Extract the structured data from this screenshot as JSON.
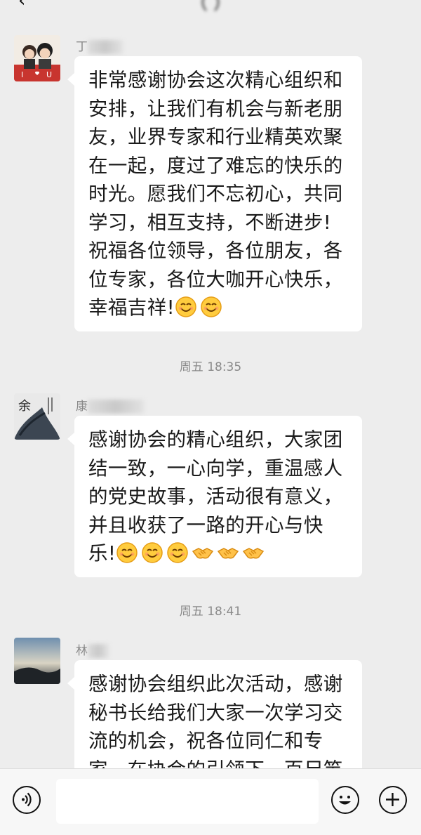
{
  "header": {
    "back_glyph": "‹",
    "title": "(obscured chat title)"
  },
  "messages": [
    {
      "sender": "丁",
      "text": "非常感谢协会这次精心组织和安排，让我们有机会与新老朋友，业界专家和行业精英欢聚在一起，度过了难忘的快乐的时光。愿我们不忘初心，共同学习，相互支持，不断进步!祝福各位领导，各位朋友，各位专家，各位大咖开心快乐，幸福吉祥!",
      "emojis": [
        "smile-emoji",
        "smile-emoji"
      ]
    },
    {
      "sender": "康",
      "text": "感谢协会的精心组织，大家团结一致，一心向学，重温感人的党史故事，活动很有意义，并且收获了一路的开心与快乐!",
      "emojis": [
        "smile-emoji",
        "smile-emoji",
        "smile-emoji",
        "handshake-emoji",
        "handshake-emoji",
        "handshake-emoji"
      ]
    },
    {
      "sender": "林",
      "text": "感谢协会组织此次活动，感谢秘书长给我们大家一次学习交流的机会，祝各位同仁和专家，在协会的引领下，百尺竿头更进一步!",
      "emojis": []
    }
  ],
  "timestamps": [
    "周五  18:35",
    "周五  18:41"
  ],
  "bottom": {
    "voice_icon": "voice-icon",
    "emoji_icon": "emoji-icon",
    "plus_icon": "plus-icon",
    "input_value": ""
  },
  "colors": {
    "background": "#ededed",
    "bubble": "#ffffff",
    "text": "#1a1a1a",
    "meta": "#8a8a8a"
  }
}
